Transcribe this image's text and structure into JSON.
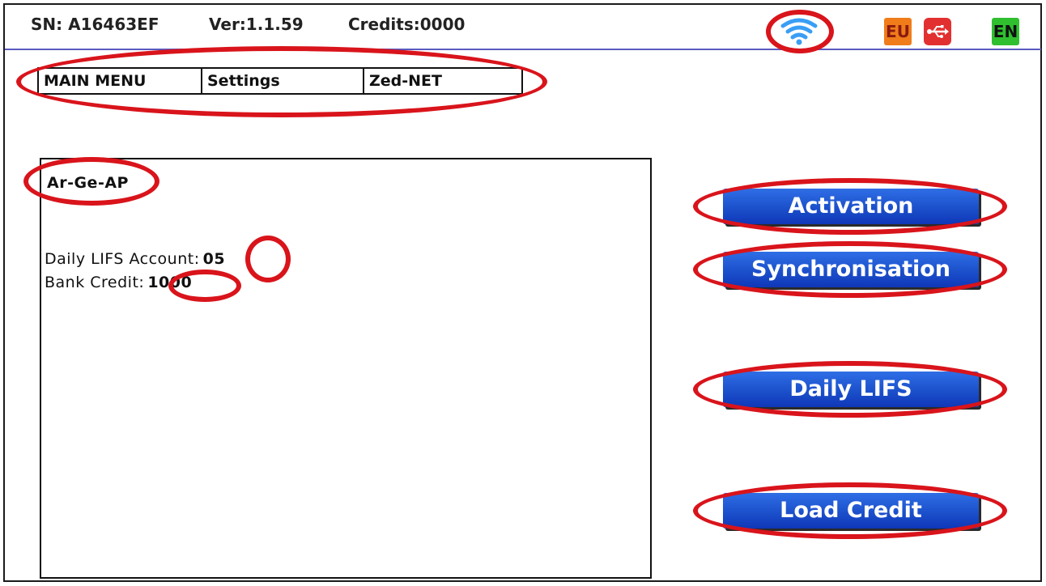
{
  "status": {
    "serial": "SN: A16463EF",
    "version": "Ver:1.1.59",
    "credits": "Credits:0000",
    "region_badge": "EU",
    "language_badge": "EN",
    "colors": {
      "wifi": "#3a9ef5",
      "eu": "#f07c1a",
      "usb": "#e23030",
      "en": "#2fbf2f"
    }
  },
  "menu": {
    "tabs": [
      {
        "label": "MAIN MENU"
      },
      {
        "label": "Settings"
      },
      {
        "label": "Zed-NET"
      }
    ]
  },
  "panel": {
    "network_name": "Ar-Ge-AP",
    "daily_lifs_label": "Daily LIFS Account:",
    "daily_lifs_value": "05",
    "bank_credit_label": "Bank Credit:",
    "bank_credit_value": "1000"
  },
  "actions": {
    "activation": "Activation",
    "synchronisation": "Synchronisation",
    "daily_lifs": "Daily LIFS",
    "load_credit": "Load Credit"
  },
  "highlight_color": "#d9141b"
}
